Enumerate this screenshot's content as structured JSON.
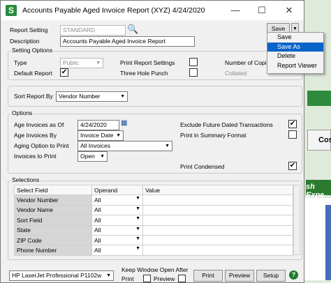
{
  "window": {
    "title": "Accounts Payable Aged Invoice Report (XYZ) 4/24/2020",
    "app_icon_letter": "S"
  },
  "titlebar": {
    "minimize": "—",
    "maximize": "☐",
    "close": "✕"
  },
  "report": {
    "setting_label": "Report Setting",
    "setting_value": "STANDARD",
    "description_label": "Description",
    "description_value": "Accounts Payable Aged Invoice Report",
    "save_label": "Save"
  },
  "save_menu": {
    "items": [
      "Save",
      "Save As",
      "Delete",
      "Report Viewer"
    ],
    "selected": 1
  },
  "setting_options": {
    "title": "Setting Options",
    "type_label": "Type",
    "type_value": "Public",
    "default_report_label": "Default Report",
    "default_report_checked": "✔",
    "print_report_settings_label": "Print Report Settings",
    "three_hole_punch_label": "Three Hole Punch",
    "number_of_copies_label": "Number of Copies",
    "collated_label": "Collated"
  },
  "sort": {
    "label": "Sort Report By",
    "value": "Vendor Number"
  },
  "options": {
    "title": "Options",
    "age_invoices_as_of_label": "Age Invoices as Of",
    "age_invoices_as_of_value": "4/24/2020",
    "age_invoices_by_label": "Age Invoices By",
    "age_invoices_by_value": "Invoice Date",
    "aging_option_label": "Aging Option to Print",
    "aging_option_value": "All Invoices",
    "invoices_to_print_label": "Invoices to Print",
    "invoices_to_print_value": "Open",
    "exclude_future_label": "Exclude Future Dated Transactions",
    "exclude_future_checked": "✔",
    "print_summary_label": "Print in Summary Format",
    "print_condensed_label": "Print Condensed",
    "print_condensed_checked": "✔"
  },
  "selections": {
    "title": "Selections",
    "headers": [
      "Select Field",
      "Operand",
      "Value"
    ],
    "rows": [
      {
        "field": "Vendor Number",
        "operand": "All",
        "value": ""
      },
      {
        "field": "Vendor Name",
        "operand": "All",
        "value": ""
      },
      {
        "field": "Sort Field",
        "operand": "All",
        "value": ""
      },
      {
        "field": "State",
        "operand": "All",
        "value": ""
      },
      {
        "field": "ZIP Code",
        "operand": "All",
        "value": ""
      },
      {
        "field": "Phone Number",
        "operand": "All",
        "value": ""
      }
    ]
  },
  "footer": {
    "printer_value": "HP LaserJet Professional P1102w",
    "keep_open_label": "Keep Window Open After",
    "print_label": "Print",
    "preview_label": "Preview",
    "print_button": "Print",
    "preview_button": "Preview",
    "setup_button": "Setup",
    "help_glyph": "?"
  },
  "background": {
    "cos_text": "Cos",
    "exp_text": "sh Expe"
  }
}
